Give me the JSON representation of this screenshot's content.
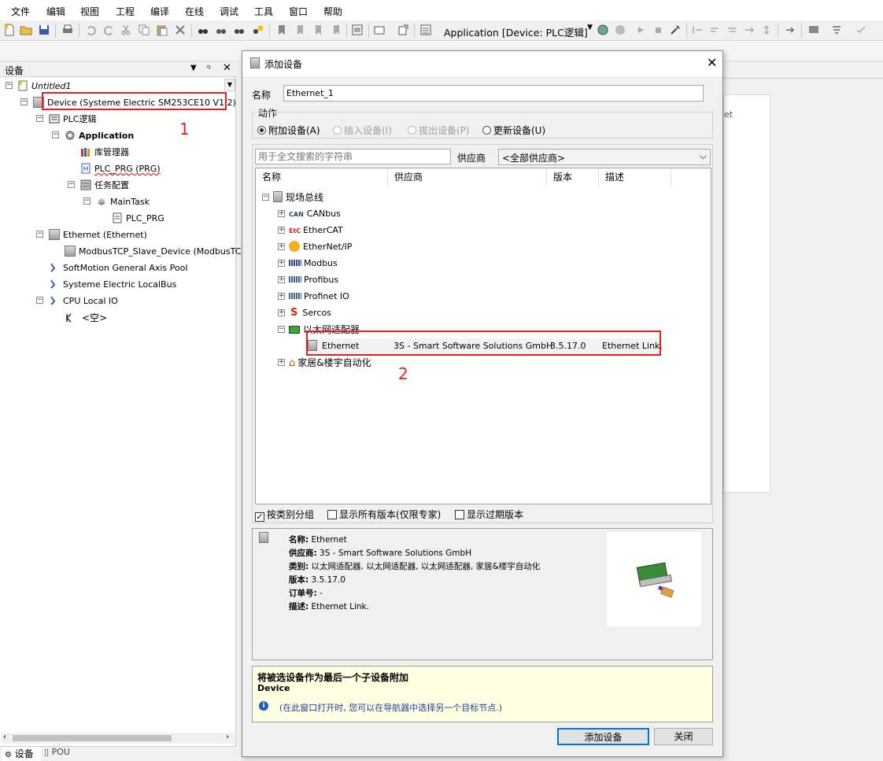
{
  "menu": [
    "文件",
    "编辑",
    "视图",
    "工程",
    "编译",
    "在线",
    "调试",
    "工具",
    "窗口",
    "帮助"
  ],
  "toolbar": {
    "app_combo": "Application [Device: PLC逻辑]"
  },
  "left_panel": {
    "title": "设备",
    "project": "Untitled1",
    "tree": [
      "Device (Systeme Electric SM253CE10 V1.2)",
      "PLC逻辑",
      "Application",
      "库管理器",
      "PLC_PRG (PRG)",
      "任务配置",
      "MainTask",
      "PLC_PRG",
      "Ethernet (Ethernet)",
      "ModbusTCP_Slave_Device (ModbusTCP S",
      "SoftMotion General Axis Pool",
      "Systeme Electric LocalBus",
      "CPU Local IO",
      "<空>"
    ],
    "tabs": [
      "设备",
      "POU"
    ]
  },
  "annotations": {
    "one": "1",
    "two": "2"
  },
  "dialog": {
    "title": "添加设备",
    "name_label": "名称",
    "name_value": "Ethernet_1",
    "action_label": "动作",
    "actions": [
      {
        "label": "附加设备(A)",
        "selected": true,
        "enabled": true
      },
      {
        "label": "插入设备(I)",
        "selected": false,
        "enabled": false
      },
      {
        "label": "拔出设备(P)",
        "selected": false,
        "enabled": false
      },
      {
        "label": "更新设备(U)",
        "selected": false,
        "enabled": true
      }
    ],
    "search_placeholder": "用于全文搜索的字符串",
    "vendor_label": "供应商",
    "vendor_value": "<全部供应商>",
    "columns": [
      "名称",
      "供应商",
      "版本",
      "描述"
    ],
    "root_group": "现场总线",
    "groups": [
      "CANbus",
      "EtherCAT",
      "EtherNet/IP",
      "Modbus",
      "Profibus",
      "Profinet IO",
      "Sercos",
      "以太网适配器"
    ],
    "selected_device": {
      "name": "Ethernet",
      "vendor": "3S - Smart Software Solutions GmbH",
      "version": "3.5.17.0",
      "description": "Ethernet Link."
    },
    "extra_group": "家居&楼宇自动化",
    "options": [
      {
        "label": "按类别分组",
        "checked": true
      },
      {
        "label": "显示所有版本(仅限专家)",
        "checked": false
      },
      {
        "label": "显示过期版本",
        "checked": false
      }
    ],
    "info": {
      "name_k": "名称:",
      "name_v": "Ethernet",
      "vendor_k": "供应商:",
      "vendor_v": "3S - Smart Software Solutions GmbH",
      "category_k": "类别:",
      "category_v": "以太网适配器, 以太网适配器, 以太网适配器, 家居&楼宇自动化",
      "version_k": "版本:",
      "version_v": "3.5.17.0",
      "order_k": "订单号:",
      "order_v": "-",
      "desc_k": "描述:",
      "desc_v": "Ethernet Link."
    },
    "note_title": "将被选设备作为最后一个子设备附加",
    "note_target": "Device",
    "note_hint": "(在此窗口打开时, 您可以在导航器中选择另一个目标节点.)",
    "add_button": "添加设备",
    "close_button": "关闭"
  },
  "right_area": {
    "partial_text": "et"
  }
}
